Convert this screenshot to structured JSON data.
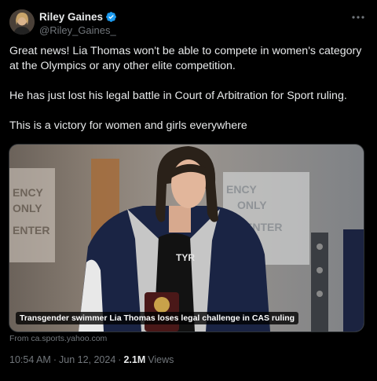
{
  "author": {
    "display_name": "Riley Gaines",
    "handle": "@Riley_Gaines_",
    "verified": true
  },
  "post": {
    "paragraphs": [
      "Great news! Lia Thomas won't be able to compete in women's category at the Olympics or any other elite competition.",
      "He has just lost his legal battle in Court of Arbitration for Sport ruling.",
      "This is a victory for women and girls everywhere"
    ]
  },
  "card": {
    "headline": "Transgender swimmer Lia Thomas loses legal challenge in CAS ruling",
    "source": "From ca.sports.yahoo.com",
    "jacket_brand": "TYR",
    "backdrop_text": [
      "ENCY",
      "ONLY",
      "ENTER"
    ]
  },
  "meta": {
    "time": "10:54 AM",
    "date": "Jun 12, 2024",
    "views_count": "2.1M",
    "views_label": "Views"
  },
  "colors": {
    "background": "#000000",
    "text_primary": "#e7e9ea",
    "text_secondary": "#71767b",
    "verified_blue": "#1d9bf0",
    "border": "#2f3336"
  },
  "icons": {
    "verified": "verified-badge-icon",
    "more": "more-options-icon"
  }
}
